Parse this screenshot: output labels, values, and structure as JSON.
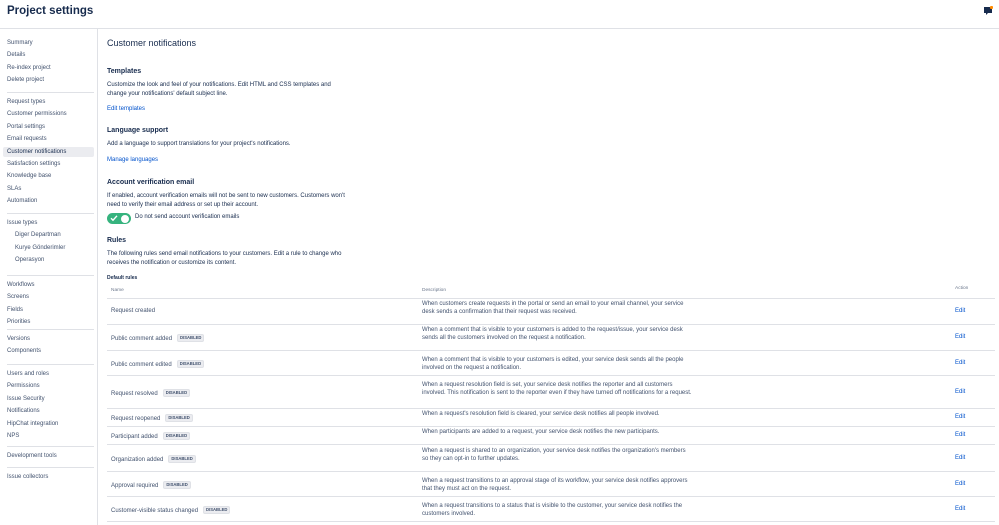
{
  "header": {
    "title": "Project settings"
  },
  "sidebar": {
    "groups": [
      [
        "Summary",
        "Details",
        "Re-index project",
        "Delete project"
      ],
      [
        "Request types",
        "Customer permissions",
        "Portal settings",
        "Email requests",
        "Customer notifications",
        "Satisfaction settings",
        "Knowledge base",
        "SLAs",
        "Automation"
      ],
      [
        "Issue types",
        "Diger Departman",
        "Kurye Gönderimler",
        "Operasyon"
      ],
      [
        "Workflows",
        "Screens",
        "Fields",
        "Priorities"
      ],
      [
        "Versions",
        "Components"
      ],
      [
        "Users and roles",
        "Permissions",
        "Issue Security",
        "Notifications",
        "HipChat integration",
        "NPS"
      ],
      [
        "Development tools"
      ],
      [
        "Issue collectors"
      ]
    ],
    "active": "Customer notifications"
  },
  "main": {
    "title": "Customer notifications",
    "templates": {
      "title": "Templates",
      "desc": "Customize the look and feel of your notifications. Edit HTML and CSS templates and change your notifications' default subject line.",
      "link": "Edit templates"
    },
    "language": {
      "title": "Language support",
      "desc": "Add a language to support translations for your project's notifications.",
      "link": "Manage languages"
    },
    "verification": {
      "title": "Account verification email",
      "desc": "If enabled, account verification emails will not be sent to new customers. Customers won't need to verify their email address or set up their account.",
      "toggle_label": "Do not send account verification emails",
      "enabled": true
    },
    "rules": {
      "title": "Rules",
      "desc": "The following rules send email notifications to your customers. Edit a rule to change who receives the notification or customize its content.",
      "table_caption": "Default rules",
      "headers": {
        "name": "Name",
        "description": "Description",
        "action": "Action"
      },
      "rows": [
        {
          "name": "Request created",
          "badge": "",
          "desc": "When customers create requests in the portal or send an email to your email channel, your service desk sends a confirmation that their request was received.",
          "action": "Edit"
        },
        {
          "name": "Public comment added",
          "badge": "DISABLED",
          "desc": "When a comment that is visible to your customers is added to the request/issue, your service desk sends all the customers involved on the request a notification.",
          "action": "Edit"
        },
        {
          "name": "Public comment edited",
          "badge": "DISABLED",
          "desc": "When a comment that is visible to your customers is edited, your service desk sends all the people involved on the request a notification.",
          "action": "Edit"
        },
        {
          "name": "Request resolved",
          "badge": "DISABLED",
          "desc": "When a request resolution field is set, your service desk notifies the reporter and all customers involved. This notification is sent to the reporter even if they have turned off notifications for a request.",
          "action": "Edit"
        },
        {
          "name": "Request reopened",
          "badge": "DISABLED",
          "desc": "When a request's resolution field is cleared, your service desk notifies all people involved.",
          "action": "Edit"
        },
        {
          "name": "Participant added",
          "badge": "DISABLED",
          "desc": "When participants are added to a request, your service desk notifies the new participants.",
          "action": "Edit"
        },
        {
          "name": "Organization added",
          "badge": "DISABLED",
          "desc": "When a request is shared to an organization, your service desk notifies the organization's members so they can opt-in to further updates.",
          "action": "Edit"
        },
        {
          "name": "Approval required",
          "badge": "DISABLED",
          "desc": "When a request transitions to an approval stage of its workflow, your service desk notifies approvers that they must act on the request.",
          "action": "Edit"
        },
        {
          "name": "Customer-visible status changed",
          "badge": "DISABLED",
          "desc": "When a request transitions to a status that is visible to the customer, your service desk notifies the customers involved.",
          "action": "Edit"
        }
      ]
    }
  },
  "colors": {
    "link": "#0052cc",
    "toggle_on": "#36b37e",
    "text": "#172b4d",
    "muted": "#42526e"
  },
  "icons": {
    "help": "help-icon",
    "toggle_check": "check-icon"
  }
}
